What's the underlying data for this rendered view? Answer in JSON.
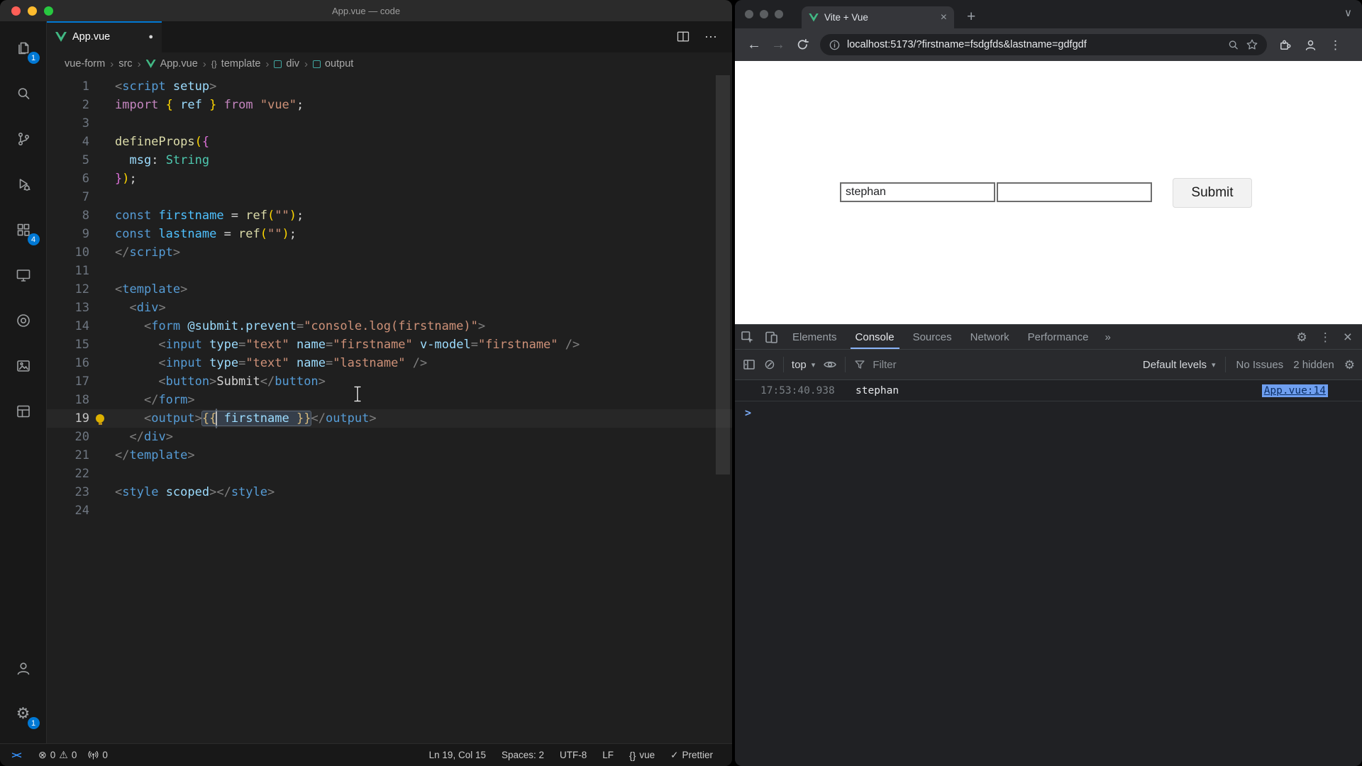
{
  "glyphs": {
    "chevron_sep": "›",
    "ellipsis": "⋯",
    "kebab": "⋮",
    "close": "×",
    "more": "»",
    "plus": "+",
    "caret": "▾",
    "back": "←",
    "forward": "→",
    "check": "✓",
    "error": "⊗",
    "warning": "⚠",
    "remote": "><",
    "braces": "{}",
    "tab_search": "∨",
    "prompt": ">",
    "dot": "●",
    "gear": "⚙",
    "clear": "⊘"
  },
  "vscode": {
    "window_title": "App.vue — code",
    "tab": {
      "label": "App.vue"
    },
    "activity": {
      "explorer_badge": "1",
      "extensions_badge": "4",
      "settings_badge": "1"
    },
    "breadcrumbs": [
      {
        "label": "vue-form"
      },
      {
        "label": "src"
      },
      {
        "label": "App.vue",
        "icon": "vue"
      },
      {
        "label": "template",
        "icon": "braces"
      },
      {
        "label": "div",
        "icon": "element"
      },
      {
        "label": "output",
        "icon": "element"
      }
    ],
    "editor": {
      "active_line": 19,
      "lines": [
        {
          "n": 1,
          "t": [
            [
              "p",
              "<"
            ],
            [
              "tag",
              "script"
            ],
            [
              "tx",
              " "
            ],
            [
              "at",
              "setup"
            ],
            [
              "p",
              ">"
            ]
          ]
        },
        {
          "n": 2,
          "t": [
            [
              "kw",
              "import"
            ],
            [
              "tx",
              " "
            ],
            [
              "b1",
              "{"
            ],
            [
              "tx",
              " "
            ],
            [
              "vr",
              "ref"
            ],
            [
              "tx",
              " "
            ],
            [
              "b1",
              "}"
            ],
            [
              "tx",
              " "
            ],
            [
              "kw",
              "from"
            ],
            [
              "tx",
              " "
            ],
            [
              "st",
              "\"vue\""
            ],
            [
              "tx",
              ";"
            ]
          ]
        },
        {
          "n": 3,
          "t": []
        },
        {
          "n": 4,
          "t": [
            [
              "fn",
              "defineProps"
            ],
            [
              "b1",
              "("
            ],
            [
              "b2",
              "{"
            ]
          ]
        },
        {
          "n": 5,
          "t": [
            [
              "tx",
              "  "
            ],
            [
              "vr",
              "msg"
            ],
            [
              "tx",
              ": "
            ],
            [
              "ty",
              "String"
            ]
          ]
        },
        {
          "n": 6,
          "t": [
            [
              "b2",
              "}"
            ],
            [
              "b1",
              ")"
            ],
            [
              "tx",
              ";"
            ]
          ]
        },
        {
          "n": 7,
          "t": []
        },
        {
          "n": 8,
          "t": [
            [
              "kc",
              "const"
            ],
            [
              "tx",
              " "
            ],
            [
              "cv",
              "firstname"
            ],
            [
              "tx",
              " = "
            ],
            [
              "fn",
              "ref"
            ],
            [
              "b1",
              "("
            ],
            [
              "st",
              "\"\""
            ],
            [
              "b1",
              ")"
            ],
            [
              "tx",
              ";"
            ]
          ]
        },
        {
          "n": 9,
          "t": [
            [
              "kc",
              "const"
            ],
            [
              "tx",
              " "
            ],
            [
              "cv",
              "lastname"
            ],
            [
              "tx",
              " = "
            ],
            [
              "fn",
              "ref"
            ],
            [
              "b1",
              "("
            ],
            [
              "st",
              "\"\""
            ],
            [
              "b1",
              ")"
            ],
            [
              "tx",
              ";"
            ]
          ]
        },
        {
          "n": 10,
          "t": [
            [
              "p",
              "</"
            ],
            [
              "tag",
              "script"
            ],
            [
              "p",
              ">"
            ]
          ]
        },
        {
          "n": 11,
          "t": []
        },
        {
          "n": 12,
          "t": [
            [
              "p",
              "<"
            ],
            [
              "tag",
              "template"
            ],
            [
              "p",
              ">"
            ]
          ]
        },
        {
          "n": 13,
          "t": [
            [
              "tx",
              "  "
            ],
            [
              "p",
              "<"
            ],
            [
              "tag",
              "div"
            ],
            [
              "p",
              ">"
            ]
          ]
        },
        {
          "n": 14,
          "t": [
            [
              "tx",
              "    "
            ],
            [
              "p",
              "<"
            ],
            [
              "tag",
              "form"
            ],
            [
              "tx",
              " "
            ],
            [
              "at",
              "@submit.prevent"
            ],
            [
              "p",
              "="
            ],
            [
              "st",
              "\"console.log(firstname)\""
            ],
            [
              "p",
              ">"
            ]
          ]
        },
        {
          "n": 15,
          "t": [
            [
              "tx",
              "      "
            ],
            [
              "p",
              "<"
            ],
            [
              "tag",
              "input"
            ],
            [
              "tx",
              " "
            ],
            [
              "at",
              "type"
            ],
            [
              "p",
              "="
            ],
            [
              "st",
              "\"text\""
            ],
            [
              "tx",
              " "
            ],
            [
              "at",
              "name"
            ],
            [
              "p",
              "="
            ],
            [
              "st",
              "\"firstname\""
            ],
            [
              "tx",
              " "
            ],
            [
              "at",
              "v-model"
            ],
            [
              "p",
              "="
            ],
            [
              "st",
              "\"firstname\""
            ],
            [
              "tx",
              " "
            ],
            [
              "p",
              "/>"
            ]
          ]
        },
        {
          "n": 16,
          "t": [
            [
              "tx",
              "      "
            ],
            [
              "p",
              "<"
            ],
            [
              "tag",
              "input"
            ],
            [
              "tx",
              " "
            ],
            [
              "at",
              "type"
            ],
            [
              "p",
              "="
            ],
            [
              "st",
              "\"text\""
            ],
            [
              "tx",
              " "
            ],
            [
              "at",
              "name"
            ],
            [
              "p",
              "="
            ],
            [
              "st",
              "\"lastname\""
            ],
            [
              "tx",
              " "
            ],
            [
              "p",
              "/>"
            ]
          ]
        },
        {
          "n": 17,
          "t": [
            [
              "tx",
              "      "
            ],
            [
              "p",
              "<"
            ],
            [
              "tag",
              "button"
            ],
            [
              "p",
              ">"
            ],
            [
              "tx",
              "Submit"
            ],
            [
              "p",
              "</"
            ],
            [
              "tag",
              "button"
            ],
            [
              "p",
              ">"
            ]
          ]
        },
        {
          "n": 18,
          "t": [
            [
              "tx",
              "    "
            ],
            [
              "p",
              "</"
            ],
            [
              "tag",
              "form"
            ],
            [
              "p",
              ">"
            ]
          ]
        },
        {
          "n": 19,
          "bulb": true,
          "t": [
            [
              "tx",
              "    "
            ],
            [
              "p",
              "<"
            ],
            [
              "tag",
              "output"
            ],
            [
              "p",
              ">"
            ],
            {
              "g": [
                [
                  "ib",
                  "{{"
                ],
                [
                  "cur",
                  ""
                ],
                [
                  "tx",
                  " "
                ],
                [
                  "vr",
                  "firstname"
                ],
                [
                  "tx",
                  " "
                ],
                [
                  "ib",
                  "}}"
                ]
              ]
            },
            [
              "p",
              "</"
            ],
            [
              "tag",
              "output"
            ],
            [
              "p",
              ">"
            ]
          ]
        },
        {
          "n": 20,
          "t": [
            [
              "tx",
              "  "
            ],
            [
              "p",
              "</"
            ],
            [
              "tag",
              "div"
            ],
            [
              "p",
              ">"
            ]
          ]
        },
        {
          "n": 21,
          "t": [
            [
              "p",
              "</"
            ],
            [
              "tag",
              "template"
            ],
            [
              "p",
              ">"
            ]
          ]
        },
        {
          "n": 22,
          "t": []
        },
        {
          "n": 23,
          "t": [
            [
              "p",
              "<"
            ],
            [
              "tag",
              "style"
            ],
            [
              "tx",
              " "
            ],
            [
              "at",
              "scoped"
            ],
            [
              "p",
              "></"
            ],
            [
              "tag",
              "style"
            ],
            [
              "p",
              ">"
            ]
          ]
        },
        {
          "n": 24,
          "t": []
        }
      ]
    },
    "status": {
      "errors": "0",
      "warnings": "0",
      "ports": "0",
      "line_col": "Ln 19, Col 15",
      "indent": "Spaces: 2",
      "encoding": "UTF-8",
      "eol": "LF",
      "language": "vue",
      "formatter": "Prettier"
    }
  },
  "browser": {
    "tab_title": "Vite + Vue",
    "url": "localhost:5173/?firstname=fsdgfds&lastname=gdfgdf",
    "page": {
      "firstname_value": "stephan",
      "submit_label": "Submit"
    },
    "devtools": {
      "tabs": [
        {
          "label": "Elements"
        },
        {
          "label": "Console",
          "active": true
        },
        {
          "label": "Sources"
        },
        {
          "label": "Network"
        },
        {
          "label": "Performance"
        }
      ],
      "toolbar": {
        "context": "top",
        "filter": "Filter",
        "levels": "Default levels",
        "issues": "No Issues",
        "hidden": "2 hidden"
      },
      "console": [
        {
          "time": "17:53:40.938",
          "text": "stephan",
          "source": "App.vue:14"
        }
      ]
    }
  }
}
